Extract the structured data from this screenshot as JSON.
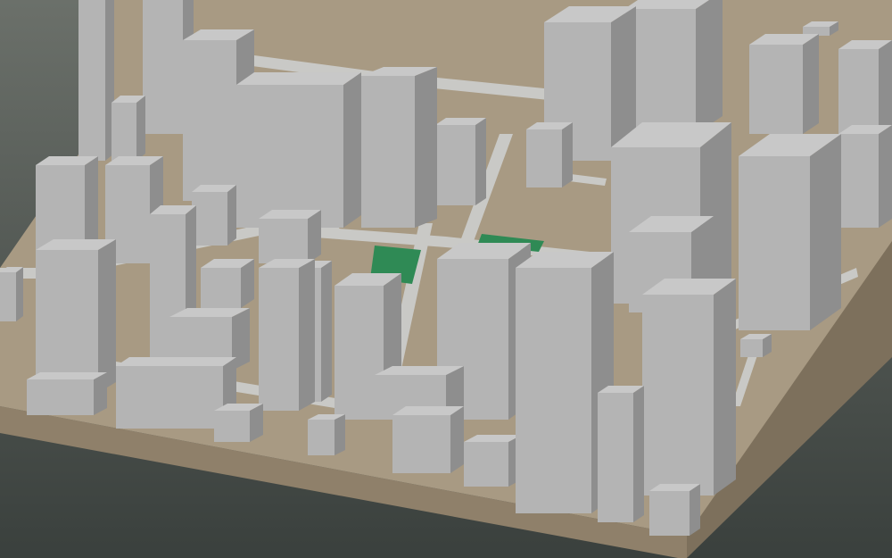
{
  "scene": {
    "kind": "3d-city-block-model",
    "colors": {
      "background_top": "#6b706a",
      "background_bottom": "#3a403d",
      "ground": "#a89a83",
      "base_front": "#8f806a",
      "base_side": "#7d705c",
      "road": "#c9c9c6",
      "building_top": "#c8c8c8",
      "building_front": "#b4b4b4",
      "building_side": "#8e8e8e",
      "park": "#2f8a55"
    }
  }
}
